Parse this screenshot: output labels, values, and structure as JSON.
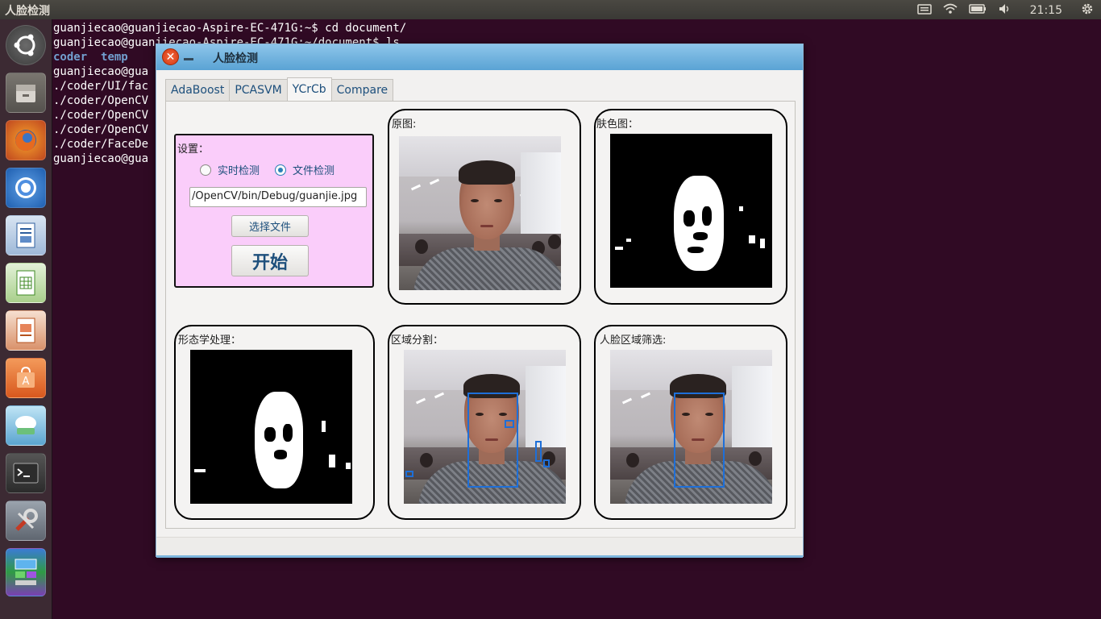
{
  "top_panel": {
    "title": "人脸检测",
    "time": "21:15",
    "icons": [
      "keyboard-icon",
      "wifi-icon",
      "battery-icon",
      "volume-icon",
      "gear-icon"
    ]
  },
  "launcher": {
    "items": [
      "ubuntu-dash-icon",
      "files-icon",
      "firefox-icon",
      "chromium-icon",
      "writer-icon",
      "calc-icon",
      "impress-icon",
      "software-center-icon",
      "remmina-icon",
      "terminal-icon",
      "settings-icon",
      "workspaces-icon"
    ]
  },
  "terminal": {
    "lines": [
      "guanjiecao@guanjiecao-Aspire-EC-471G:~$ cd document/",
      "guanjiecao@guanjiecao-Aspire-EC-471G:~/document$ ls",
      "",
      "guanjiecao@gua",
      "./coder/UI/fac",
      "./coder/OpenCV",
      "./coder/OpenCV",
      "./coder/OpenCV",
      "./coder/FaceDe",
      "guanjiecao@gua"
    ],
    "dir_1": "coder",
    "dir_2": "temp"
  },
  "window": {
    "title": "人脸检测",
    "tabs": [
      "AdaBoost",
      "PCASVM",
      "YCrCb",
      "Compare"
    ],
    "active_tab": "YCrCb",
    "settings": {
      "label": "设置：",
      "radio_realtime": "实时检测",
      "radio_file": "文件检测",
      "selected_radio": "文件检测",
      "file_path": "/OpenCV/bin/Debug/guanjie.jpg",
      "choose_button": "选择文件",
      "start_button": "开始"
    },
    "panels": {
      "original": "原图:",
      "skin": "肤色图：",
      "morphology": "形态学处理：",
      "segmentation": "区域分割：",
      "face_filter": "人脸区域筛选:"
    },
    "colors": {
      "settings_bg": "#facdfa",
      "titlebar": "#6fb2de",
      "detection_box": "#1e6fd8"
    }
  }
}
